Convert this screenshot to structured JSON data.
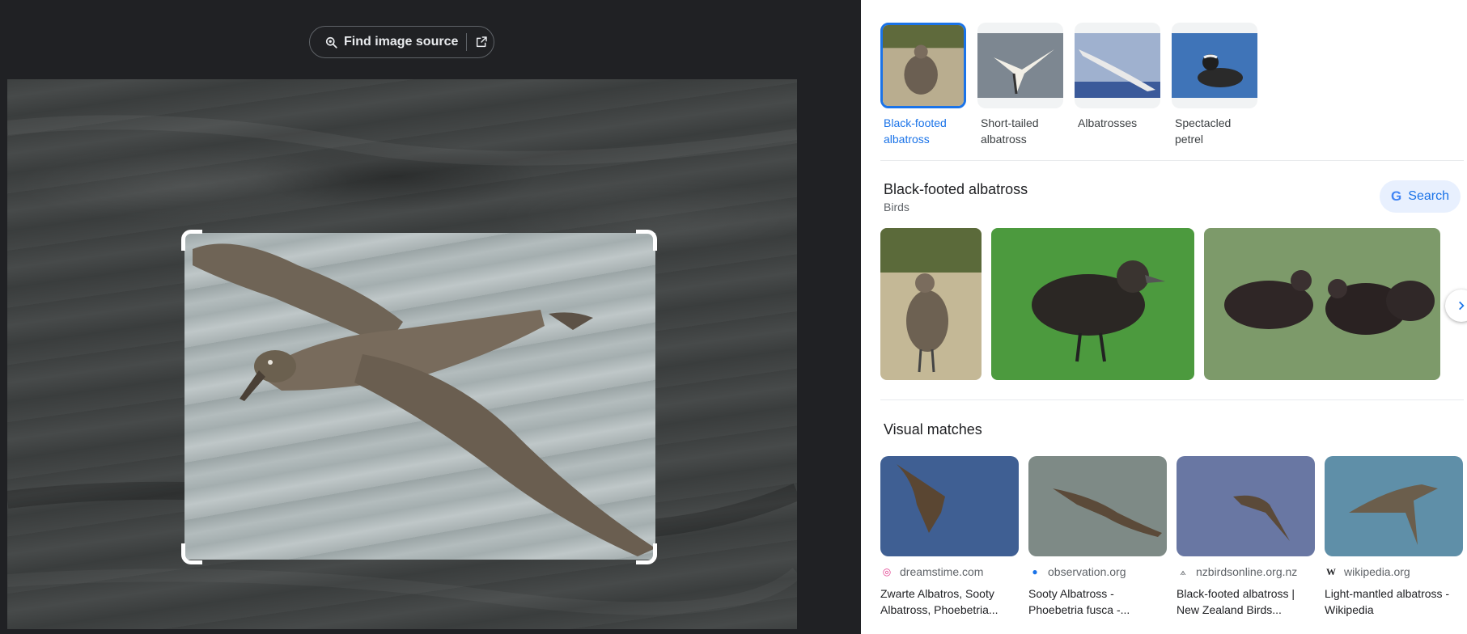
{
  "viewer": {
    "find_source_label": "Find image source",
    "icons": [
      "lens-icon",
      "external-link-icon"
    ]
  },
  "chips": [
    {
      "label": "Black-footed albatross",
      "selected": true
    },
    {
      "label": "Short-tailed albatross",
      "selected": false
    },
    {
      "label": "Albatrosses",
      "selected": false
    },
    {
      "label": "Spectacled petrel",
      "selected": false
    }
  ],
  "entity": {
    "title": "Black-footed albatross",
    "subtitle": "Birds",
    "search_label": "Search",
    "search_logo": "G"
  },
  "visual_matches": {
    "title": "Visual matches",
    "items": [
      {
        "source": "dreamstime.com",
        "caption": "Zwarte Albatros, Sooty Albatross, Phoebetria..."
      },
      {
        "source": "observation.org",
        "caption": "Sooty Albatross - Phoebetria fusca -..."
      },
      {
        "source": "nzbirdsonline.org.nz",
        "caption": "Black-footed albatross | New Zealand Birds..."
      },
      {
        "source": "wikipedia.org",
        "caption": "Light-mantled albatross - Wikipedia"
      }
    ]
  },
  "colors": {
    "accent": "#1a73e8",
    "viewer_bg": "#202124"
  }
}
